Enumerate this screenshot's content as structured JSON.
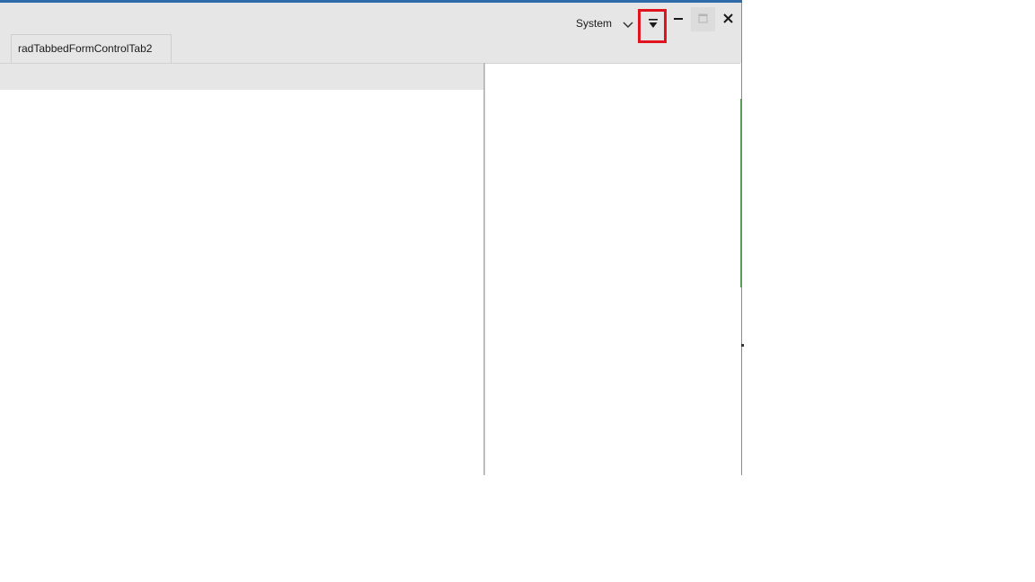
{
  "tabs": [
    {
      "label": "radTabbedFormControlTab2"
    }
  ],
  "titlebar": {
    "theme_label": "System"
  },
  "icons": {
    "theme_dropdown": "chevron-down-icon",
    "quick_access": "dropdown-arrow-icon",
    "minimize": "minimize-icon",
    "maximize": "maximize-icon",
    "close": "close-icon"
  },
  "colors": {
    "accent": "#2f6aa8",
    "highlight": "#e0141e",
    "chrome": "#e6e6e6"
  }
}
